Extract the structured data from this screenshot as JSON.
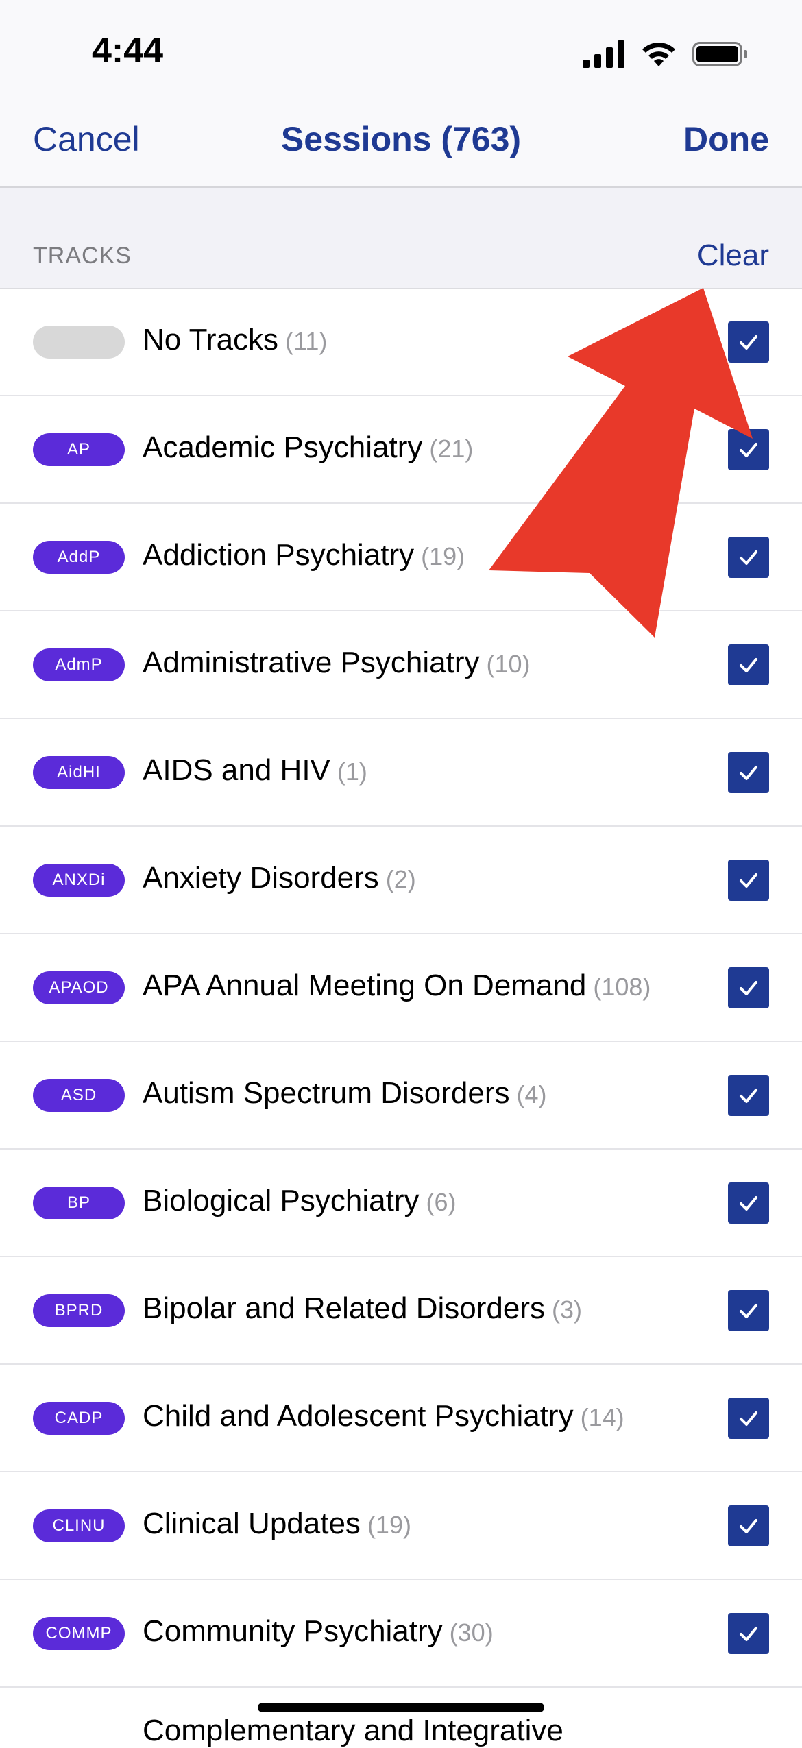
{
  "status": {
    "time": "4:44"
  },
  "nav": {
    "cancel": "Cancel",
    "title": "Sessions (763)",
    "done": "Done"
  },
  "section": {
    "title": "TRACKS",
    "clear": "Clear"
  },
  "tracks": [
    {
      "abbr": "",
      "name": "No Tracks",
      "count": "(11)",
      "checked": true
    },
    {
      "abbr": "AP",
      "name": "Academic Psychiatry",
      "count": "(21)",
      "checked": true
    },
    {
      "abbr": "AddP",
      "name": "Addiction Psychiatry",
      "count": "(19)",
      "checked": true
    },
    {
      "abbr": "AdmP",
      "name": "Administrative Psychiatry",
      "count": "(10)",
      "checked": true
    },
    {
      "abbr": "AidHI",
      "name": "AIDS and HIV",
      "count": "(1)",
      "checked": true
    },
    {
      "abbr": "ANXDi",
      "name": "Anxiety Disorders",
      "count": "(2)",
      "checked": true
    },
    {
      "abbr": "APAOD",
      "name": "APA Annual Meeting On Demand",
      "count": "(108)",
      "checked": true
    },
    {
      "abbr": "ASD",
      "name": "Autism Spectrum Disorders",
      "count": "(4)",
      "checked": true
    },
    {
      "abbr": "BP",
      "name": "Biological Psychiatry",
      "count": "(6)",
      "checked": true
    },
    {
      "abbr": "BPRD",
      "name": "Bipolar and Related Disorders",
      "count": "(3)",
      "checked": true
    },
    {
      "abbr": "CADP",
      "name": "Child and Adolescent Psychiatry",
      "count": "(14)",
      "checked": true
    },
    {
      "abbr": "CLINU",
      "name": "Clinical Updates",
      "count": "(19)",
      "checked": true
    },
    {
      "abbr": "COMMP",
      "name": "Community Psychiatry",
      "count": "(30)",
      "checked": true
    }
  ],
  "partial_row": "Complementary and Integrative",
  "colors": {
    "accent": "#1f3a93",
    "pill": "#5b2bd9",
    "arrow": "#e8392a"
  }
}
